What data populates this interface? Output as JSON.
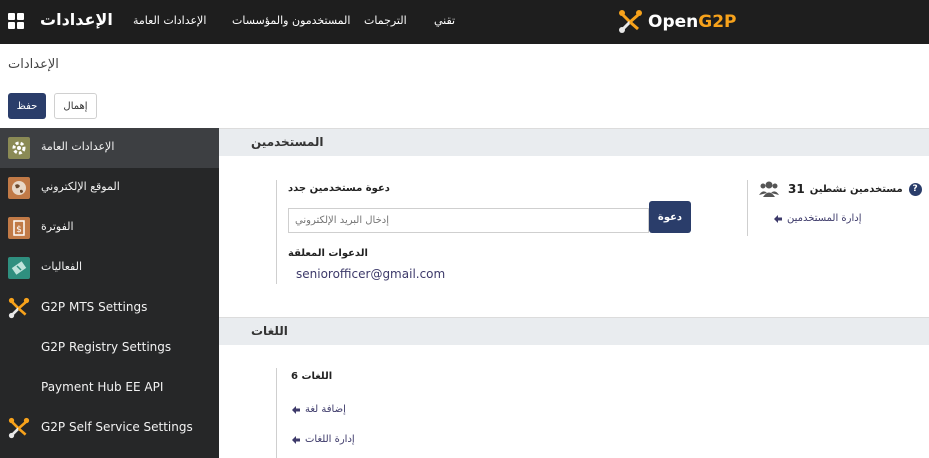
{
  "navbar": {
    "app_title": "الإعدادات",
    "menu": [
      "الإعدادات العامة",
      "المستخدمون والمؤسسات",
      "الترجمات",
      "تقني"
    ],
    "brand_open": "Open",
    "brand_g2p": "G2P"
  },
  "breadcrumb": "الإعدادات",
  "buttons": {
    "save": "حفظ",
    "discard": "إهمال"
  },
  "sidebar": {
    "items": [
      {
        "label": "الإعدادات العامة",
        "icon": "gear-icon",
        "color": "#8a8a55"
      },
      {
        "label": "الموقع الإلكتروني",
        "icon": "globe-icon",
        "color": "#c17a47"
      },
      {
        "label": "الفوترة",
        "icon": "invoice-icon",
        "color": "#c17a47"
      },
      {
        "label": "الفعاليات",
        "icon": "ticket-icon",
        "color": "#2f8f7f"
      },
      {
        "label": "G2P MTS Settings",
        "icon": "g2p-logo-icon"
      },
      {
        "label": "G2P Registry Settings",
        "icon": ""
      },
      {
        "label": "Payment Hub EE API",
        "icon": ""
      },
      {
        "label": "G2P Self Service Settings",
        "icon": "g2p-logo-icon"
      }
    ]
  },
  "users_section": {
    "title": "المستخدمين",
    "invite_title": "دعوة مستخدمين جدد",
    "invite_placeholder": "إدخال البريد الإلكتروني",
    "invite_button": "دعوة",
    "pending_title": "الدعوات المعلقة",
    "pending_email": "seniorofficer@gmail.com",
    "active_count": "31",
    "active_label": "مستخدمين نشطين",
    "manage_users": "إدارة المستخدمين"
  },
  "languages_section": {
    "title": "اللغات",
    "count_label": "اللغات 6",
    "add_language": "إضافة لغة",
    "manage_languages": "إدارة اللغات"
  },
  "colors": {
    "primary": "#2a3d6a",
    "navbar": "#1e1e1e",
    "sidebar": "#262728",
    "brand_accent": "#f7a21b"
  }
}
